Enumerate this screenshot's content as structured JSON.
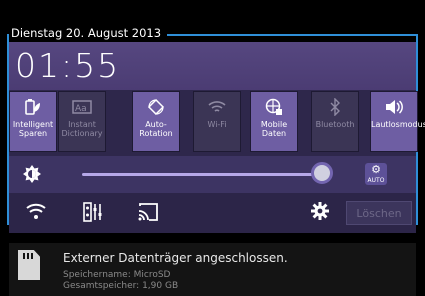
{
  "header": {
    "date": "Dienstag 20. August 2013",
    "time": "01:55"
  },
  "quick_settings": [
    {
      "label": "Intelligent Sparen",
      "icon": "battery-leaf-icon",
      "active": true
    },
    {
      "label": "Instant Dictionary",
      "icon": "dictionary-icon",
      "active": false
    },
    {
      "label": "Auto-Rotation",
      "icon": "rotate-icon",
      "active": true
    },
    {
      "label": "Wi-Fi",
      "icon": "wifi-icon",
      "active": false
    },
    {
      "label": "Mobile Daten",
      "icon": "globe-data-icon",
      "active": true
    },
    {
      "label": "Bluetooth",
      "icon": "bluetooth-icon",
      "active": false
    },
    {
      "label": "Lautlosmodus",
      "icon": "speaker-icon",
      "active": true
    }
  ],
  "brightness": {
    "level": 0.94,
    "auto_label": "AUTO"
  },
  "toolbar": {
    "clear_label": "Löschen"
  },
  "notification": {
    "title": "Externer Datenträger angeschlossen.",
    "line1": "Speichername: MicroSD",
    "line2": "Gesamtspeicher: 1,90 GB"
  },
  "colors": {
    "accent": "#2f8fd8",
    "tile_active": "#6e5ea3",
    "tile_inactive": "#3b3555"
  }
}
